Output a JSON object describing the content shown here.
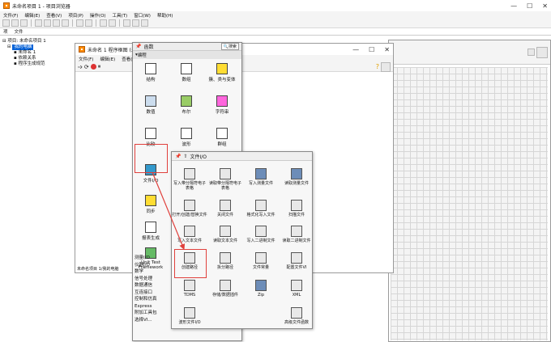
{
  "main": {
    "title": "未命名项目 1 - 项目浏览器",
    "menu": [
      "文件(F)",
      "编辑(E)",
      "查看(V)",
      "项目(P)",
      "操作(O)",
      "工具(T)",
      "窗口(W)",
      "帮助(H)"
    ],
    "tabs": [
      "项",
      "文件"
    ],
    "tree": [
      "项目: 未命名项目 1",
      "我的电脑",
      "未命名 1",
      "依赖关系",
      "程序生成规范"
    ]
  },
  "blockdiagram": {
    "title": "未命名 1 程序框图 (未命名",
    "menu": [
      "文件(F)",
      "编辑(E)",
      "查看(V)"
    ],
    "status": "未命名项目 1/我的电脑"
  },
  "palette": {
    "title": "函数",
    "search": "搜索",
    "section": "编程",
    "items": [
      "结构",
      "数组",
      "簇、类与变体",
      "数值",
      "布尔",
      "字符串",
      "比较",
      "波形",
      "群组",
      "文件I/O",
      "同步",
      "报表生成",
      "Unit Test Framework"
    ],
    "categories": [
      "测量I/O",
      "仪器I/O",
      "数学",
      "信号处理",
      "数据通信",
      "互连接口",
      "控制和仿真",
      "Express",
      "附加工具包",
      "选择VI..."
    ]
  },
  "fileio": {
    "title": "文件I/O",
    "items": [
      "写入带分隔符电子表格",
      "读取带分隔符电子表格",
      "写入测量文件",
      "读取测量文件",
      "打开/创建/替换文件",
      "关闭文件",
      "格式化写入文件",
      "扫描文件",
      "写入文本文件",
      "读取文本文件",
      "写入二进制文件",
      "读取二进制文件",
      "创建路径",
      "拆分路径",
      "文件常量",
      "配置文件VI",
      "TDMS",
      "存储/数据插件",
      "Zip",
      "XML",
      "波形文件I/O",
      "高级文件函数"
    ]
  },
  "colors": {
    "accent": "#0a64d8",
    "highlight": "#e0403c"
  }
}
